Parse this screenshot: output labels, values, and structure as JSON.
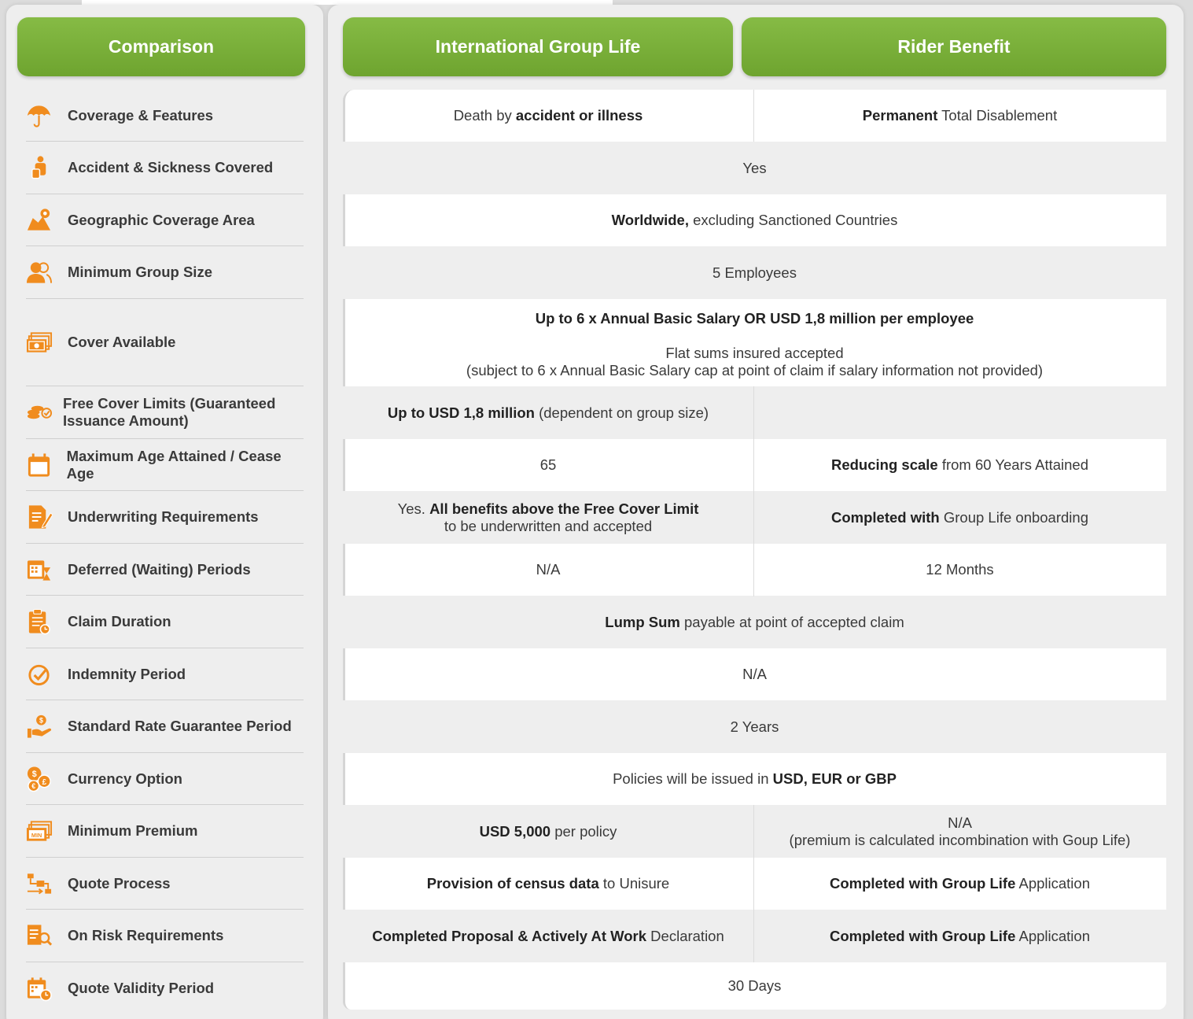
{
  "headers": {
    "comparison": "Comparison",
    "group_life": "International Group Life",
    "rider": "Rider Benefit"
  },
  "colors": {
    "accent_green": "#7bb23a",
    "icon_orange": "#f08c1e"
  },
  "rows": [
    {
      "label": "Coverage & Features",
      "icon": "umbrella-icon"
    },
    {
      "label": "Accident & Sickness Covered",
      "icon": "injured-person-icon"
    },
    {
      "label": "Geographic Coverage Area",
      "icon": "map-pin-icon"
    },
    {
      "label": "Minimum Group Size",
      "icon": "users-icon"
    },
    {
      "label": "Cover Available",
      "icon": "money-stack-icon"
    },
    {
      "label": "Free Cover Limits (Guaranteed Issuance Amount)",
      "icon": "coins-check-icon"
    },
    {
      "label": "Maximum Age Attained / Cease Age",
      "icon": "calendar-icon"
    },
    {
      "label": "Underwriting Requirements",
      "icon": "document-pen-icon"
    },
    {
      "label": "Deferred (Waiting) Periods",
      "icon": "calendar-hourglass-icon"
    },
    {
      "label": "Claim Duration",
      "icon": "clipboard-clock-icon"
    },
    {
      "label": "Indemnity Period",
      "icon": "check-circle-icon"
    },
    {
      "label": "Standard Rate Guarantee Period",
      "icon": "hand-coin-icon"
    },
    {
      "label": "Currency Option",
      "icon": "currency-coins-icon"
    },
    {
      "label": "Minimum Premium",
      "icon": "min-bill-icon"
    },
    {
      "label": "Quote Process",
      "icon": "flow-process-icon"
    },
    {
      "label": "On Risk Requirements",
      "icon": "document-search-icon"
    },
    {
      "label": "Quote Validity Period",
      "icon": "calendar-clock-icon"
    }
  ],
  "cells": {
    "r0_gl_pre": "Death by ",
    "r0_gl_bold": "accident or illness",
    "r0_rb_bold": "Permanent",
    "r0_rb_post": " Total Disablement",
    "r1": "Yes",
    "r2_bold": "Worldwide,",
    "r2_post": " excluding Sanctioned Countries",
    "r3": "5 Employees",
    "r4_bold": "Up to 6 x Annual Basic Salary OR USD 1,8 million per employee",
    "r4_line2": "Flat sums insured accepted",
    "r4_line3": "(subject to 6 x Annual Basic Salary cap at point of claim if salary information not provided)",
    "r5_gl_bold": "Up to USD 1,8 million",
    "r5_gl_post": " (dependent on group size)",
    "r6_gl": "65",
    "r6_rb_bold": "Reducing scale",
    "r6_rb_post": " from 60 Years Attained",
    "r7_gl_pre": "Yes. ",
    "r7_gl_bold": "All benefits above the Free Cover Limit",
    "r7_gl_line2": "to be underwritten and accepted",
    "r7_rb_bold": "Completed with",
    "r7_rb_post": " Group Life onboarding",
    "r8_gl": "N/A",
    "r8_rb": "12 Months",
    "r9_bold": "Lump Sum",
    "r9_post": " payable at point of accepted claim",
    "r10": "N/A",
    "r11": "2 Years",
    "r12_pre": "Policies will be issued in ",
    "r12_bold": "USD, EUR or GBP",
    "r13_gl_bold": "USD 5,000",
    "r13_gl_post": " per policy",
    "r13_rb_line1": "N/A",
    "r13_rb_line2": "(premium is calculated incombination with Goup Life)",
    "r14_gl_bold": "Provision of census data",
    "r14_gl_post": " to Unisure",
    "r14_rb_bold": "Completed with Group Life",
    "r14_rb_post": " Application",
    "r15_gl_bold": "Completed Proposal & Actively At Work",
    "r15_gl_post": " Declaration",
    "r15_rb_bold": "Completed with Group Life",
    "r15_rb_post": " Application",
    "r16": "30 Days"
  }
}
